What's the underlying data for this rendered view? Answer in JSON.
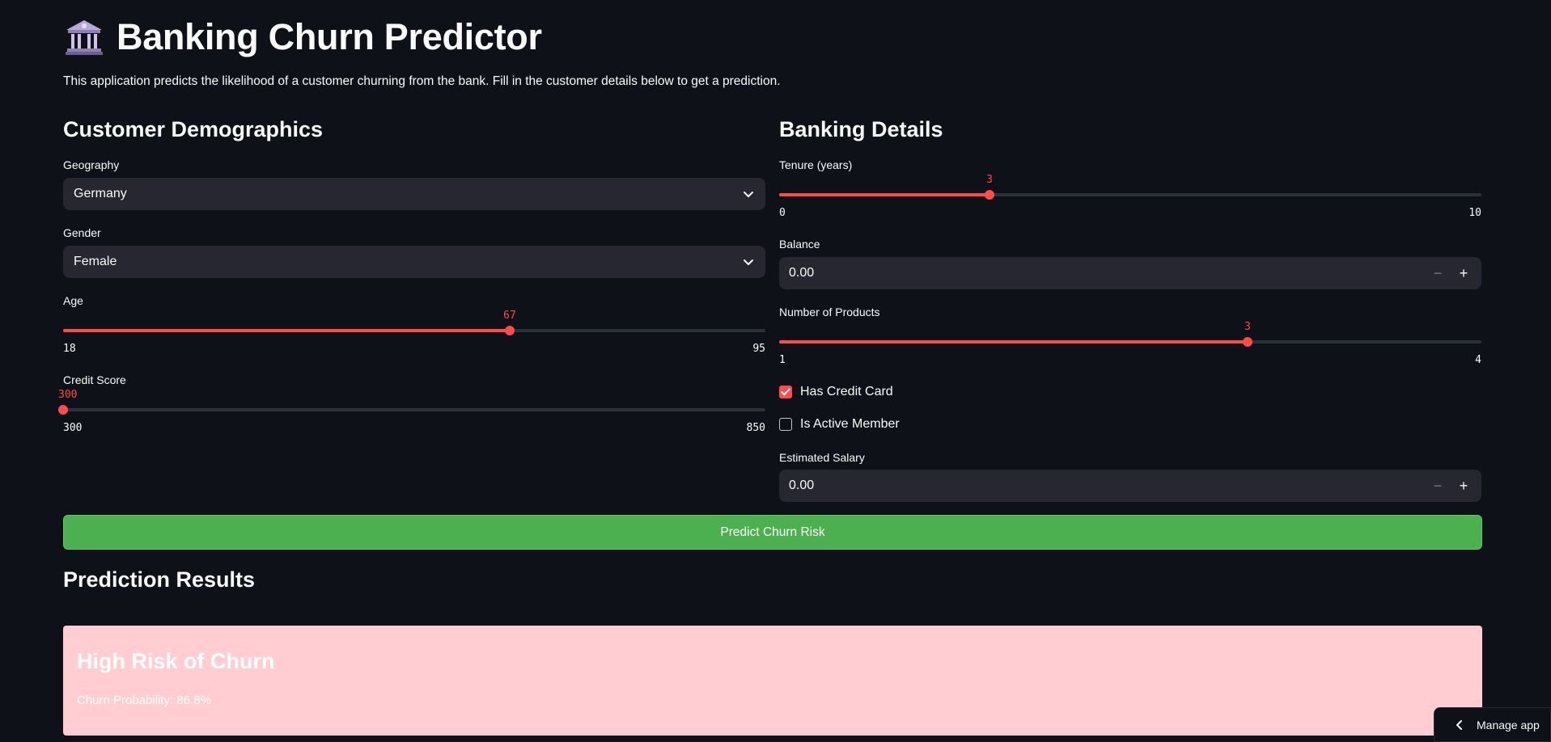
{
  "header": {
    "title": "Banking Churn Predictor",
    "intro": "This application predicts the likelihood of a customer churning from the bank. Fill in the customer details below to get a prediction."
  },
  "demographics": {
    "heading": "Customer Demographics",
    "geography": {
      "label": "Geography",
      "value": "Germany"
    },
    "gender": {
      "label": "Gender",
      "value": "Female"
    },
    "age": {
      "label": "Age",
      "value": "67",
      "min": "18",
      "max": "95",
      "fraction": 0.636
    },
    "credit_score": {
      "label": "Credit Score",
      "value": "300",
      "min": "300",
      "max": "850",
      "fraction": 0.0
    }
  },
  "banking": {
    "heading": "Banking Details",
    "tenure": {
      "label": "Tenure (years)",
      "value": "3",
      "min": "0",
      "max": "10",
      "fraction": 0.3
    },
    "balance": {
      "label": "Balance",
      "value": "0.00"
    },
    "num_products": {
      "label": "Number of Products",
      "value": "3",
      "min": "1",
      "max": "4",
      "fraction": 0.667
    },
    "has_credit_card": {
      "label": "Has Credit Card",
      "checked": true
    },
    "is_active_member": {
      "label": "Is Active Member",
      "checked": false
    },
    "salary": {
      "label": "Estimated Salary",
      "value": "0.00"
    },
    "minus": "−",
    "plus": "+"
  },
  "predict_button": "Predict Churn Risk",
  "results": {
    "heading": "Prediction Results",
    "risk_title": "High Risk of Churn",
    "probability": "Churn Probability: 86.8%"
  },
  "manage_app": "Manage app",
  "colors": {
    "accent": "#ff4b4b",
    "button": "#4caf50",
    "risk_bg": "#ffcdd2",
    "background": "#0e1117",
    "input_bg": "#262730"
  }
}
